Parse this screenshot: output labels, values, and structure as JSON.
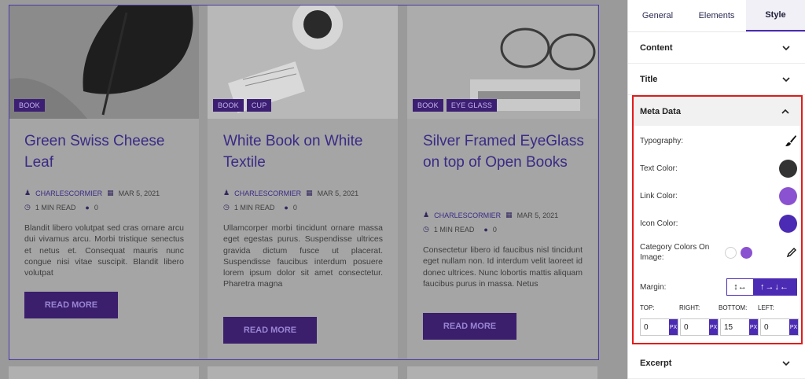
{
  "posts": [
    {
      "categories": [
        "BOOK"
      ],
      "title": "Green Swiss Cheese Leaf",
      "author": "CHARLESCORMIER",
      "date": "MAR 5, 2021",
      "read_time": "1 MIN READ",
      "comments": "0",
      "excerpt": "Blandit libero volutpat sed cras ornare arcu dui vivamus arcu. Morbi tristique senectus et netus et. Consequat mauris nunc congue nisi vitae suscipit. Blandit libero volutpat",
      "button": "READ MORE"
    },
    {
      "categories": [
        "BOOK",
        "CUP"
      ],
      "title": "White Book on White Textile",
      "author": "CHARLESCORMIER",
      "date": "MAR 5, 2021",
      "read_time": "1 MIN READ",
      "comments": "0",
      "excerpt": "Ullamcorper morbi tincidunt ornare massa eget egestas purus. Suspendisse ultrices gravida dictum fusce ut placerat. Suspendisse faucibus interdum posuere lorem ipsum dolor sit amet consectetur. Pharetra magna",
      "button": "READ MORE"
    },
    {
      "categories": [
        "BOOK",
        "EYE GLASS"
      ],
      "title": "Silver Framed EyeGlass on top of Open Books",
      "author": "CHARLESCORMIER",
      "date": "MAR 5, 2021",
      "read_time": "1 MIN READ",
      "comments": "0",
      "excerpt": "Consectetur libero id faucibus nisl tincidunt eget nullam non. Id interdum velit laoreet id donec ultrices. Nunc lobortis mattis aliquam faucibus purus in massa. Netus",
      "button": "READ MORE"
    }
  ],
  "panel": {
    "tabs": [
      "General",
      "Elements",
      "Style"
    ],
    "active_tab": "Style",
    "sections": {
      "content": "Content",
      "title": "Title",
      "meta": "Meta Data",
      "excerpt": "Excerpt"
    },
    "meta": {
      "typography_label": "Typography:",
      "text_color_label": "Text Color:",
      "link_color_label": "Link Color:",
      "icon_color_label": "Icon Color:",
      "category_colors_label": "Category Colors On Image:",
      "margin_label": "Margin:",
      "margin_toggle_a": "↕↔",
      "margin_toggle_b": "↑→↓←",
      "spacing_labels": [
        "TOP:",
        "RIGHT:",
        "BOTTOM:",
        "LEFT:"
      ],
      "spacing_values": [
        "0",
        "0",
        "15",
        "0"
      ],
      "unit": "PX"
    },
    "colors": {
      "text": "#333333",
      "link": "#8a52d0",
      "icon": "#4b2bb3",
      "category_bg": "#ffffff",
      "category_text": "#8a52d0",
      "accent": "#4b2bb3"
    }
  }
}
